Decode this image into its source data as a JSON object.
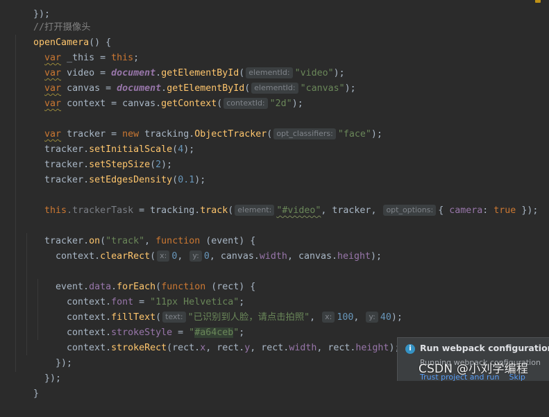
{
  "code": {
    "l0": "});",
    "comment": "//打开摄像头",
    "open": {
      "name": "openCamera",
      "rest": "() {"
    },
    "l_this": {
      "var": "var",
      "name": " _this = ",
      "val": "this",
      "end": ";"
    },
    "l_video": {
      "var": "var",
      "name": " video = ",
      "obj": "document",
      "dot": ".",
      "fn": "getElementById",
      "paren": "(",
      "hint": "elementId:",
      "str": "\"video\"",
      "end": ");"
    },
    "l_canvas": {
      "var": "var",
      "name": " canvas = ",
      "obj": "document",
      "dot": ".",
      "fn": "getElementById",
      "paren": "(",
      "hint": "elementId:",
      "str": "\"canvas\"",
      "end": ");"
    },
    "l_context": {
      "var": "var",
      "name": " context = canvas.",
      "fn": "getContext",
      "paren": "(",
      "hint": "contextId:",
      "str": "\"2d\"",
      "end": ");"
    },
    "l_tracker": {
      "var": "var",
      "name": " tracker = ",
      "new": "new",
      "ns": " tracking.",
      "fn": "ObjectTracker",
      "paren": "(",
      "hint": "opt_classifiers:",
      "str": "\"face\"",
      "end": ");"
    },
    "l_scale": {
      "obj": "tracker.",
      "fn": "setInitialScale",
      "paren": "(",
      "num": "4",
      "end": ");"
    },
    "l_step": {
      "obj": "tracker.",
      "fn": "setStepSize",
      "paren": "(",
      "num": "2",
      "end": ");"
    },
    "l_edges": {
      "obj": "tracker.",
      "fn": "setEdgesDensity",
      "paren": "(",
      "num": "0.1",
      "end": ");"
    },
    "l_task": {
      "kw": "this",
      "prop": ".trackerTask",
      "eq": " = tracking.",
      "fn": "track",
      "paren": "(",
      "hint1": "element:",
      "str": "\"#video\"",
      "mid": ", tracker, ",
      "hint2": "opt_options:",
      "brace": "{ ",
      "key": "camera",
      "colon": ": ",
      "bool": "true",
      "end": " });"
    },
    "l_on": {
      "obj": "tracker.",
      "fn": "on",
      "paren": "(",
      "str": "\"track\"",
      "comma": ", ",
      "kw": "function",
      "end": " (event) {"
    },
    "l_clear": {
      "obj": "context.",
      "fn": "clearRect",
      "paren": "(",
      "hint1": "x:",
      "num1": "0",
      "c1": ", ",
      "hint2": "y:",
      "num2": "0",
      "c2": ", canvas.",
      "p1": "width",
      "c3": ", canvas.",
      "p2": "height",
      "end": ");"
    },
    "l_each": {
      "obj": "event.",
      "prop": "data",
      "dot": ".",
      "fn": "forEach",
      "paren": "(",
      "kw": "function",
      "end": " (rect) {"
    },
    "l_font": {
      "obj": "context.",
      "prop": "font",
      "eq": " = ",
      "str": "\"11px Helvetica\"",
      "end": ";"
    },
    "l_fill": {
      "obj": "context.",
      "fn": "fillText",
      "paren": "(",
      "hint1": "text:",
      "str": "\"已识别到人脸，请点击拍照\"",
      "c1": ", ",
      "hint2": "x:",
      "num1": "100",
      "c2": ", ",
      "hint3": "y:",
      "num2": "40",
      "end": ");"
    },
    "l_stroke": {
      "obj": "context.",
      "prop": "strokeStyle",
      "eq": " = ",
      "q1": "\"",
      "hl": "#a64ceb",
      "q2": "\"",
      "end": ";"
    },
    "l_rect": {
      "obj": "context.",
      "fn": "strokeRect",
      "paren": "(rect.",
      "p1": "x",
      "c1": ", rect.",
      "p2": "y",
      "c2": ", rect.",
      "p3": "width",
      "c3": ", rect.",
      "p4": "height",
      "end": ");"
    },
    "l_close1": "});",
    "l_close2": "});",
    "l_close3": "}"
  },
  "notification": {
    "icon": "info-icon",
    "icon_glyph": "i",
    "title": "Run webpack configuration?",
    "body": "Running webpack configuration",
    "actions": [
      "Trust project and run",
      "Skip"
    ]
  },
  "watermark": "CSDN @小刘学编程",
  "colors": {
    "keyword": "#cc7832",
    "function": "#ffc66d",
    "string": "#6a8759",
    "number": "#6897bb",
    "property": "#9876aa",
    "background": "#2b2b2b",
    "link": "#589df6"
  }
}
